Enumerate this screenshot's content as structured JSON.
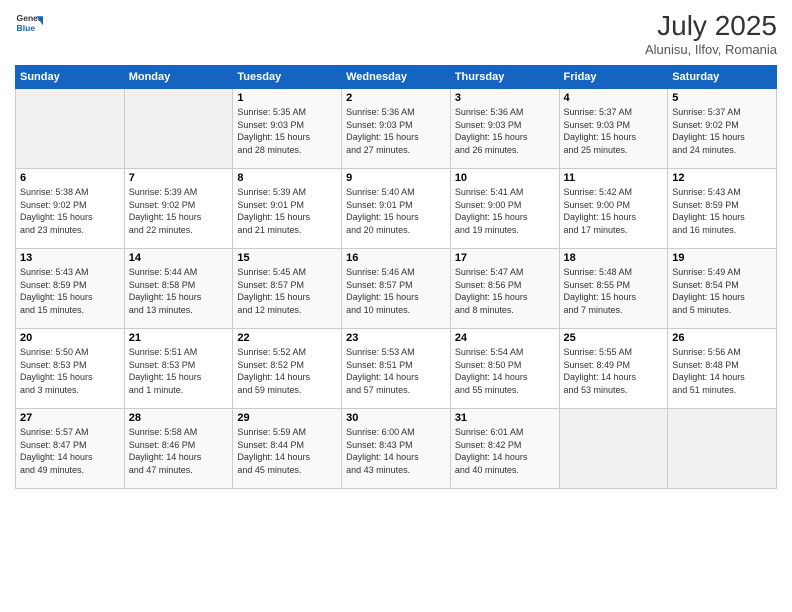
{
  "header": {
    "title": "July 2025",
    "subtitle": "Alunisu, Ilfov, Romania"
  },
  "days": [
    "Sunday",
    "Monday",
    "Tuesday",
    "Wednesday",
    "Thursday",
    "Friday",
    "Saturday"
  ],
  "weeks": [
    [
      {
        "day": "",
        "info": ""
      },
      {
        "day": "",
        "info": ""
      },
      {
        "day": "1",
        "info": "Sunrise: 5:35 AM\nSunset: 9:03 PM\nDaylight: 15 hours\nand 28 minutes."
      },
      {
        "day": "2",
        "info": "Sunrise: 5:36 AM\nSunset: 9:03 PM\nDaylight: 15 hours\nand 27 minutes."
      },
      {
        "day": "3",
        "info": "Sunrise: 5:36 AM\nSunset: 9:03 PM\nDaylight: 15 hours\nand 26 minutes."
      },
      {
        "day": "4",
        "info": "Sunrise: 5:37 AM\nSunset: 9:03 PM\nDaylight: 15 hours\nand 25 minutes."
      },
      {
        "day": "5",
        "info": "Sunrise: 5:37 AM\nSunset: 9:02 PM\nDaylight: 15 hours\nand 24 minutes."
      }
    ],
    [
      {
        "day": "6",
        "info": "Sunrise: 5:38 AM\nSunset: 9:02 PM\nDaylight: 15 hours\nand 23 minutes."
      },
      {
        "day": "7",
        "info": "Sunrise: 5:39 AM\nSunset: 9:02 PM\nDaylight: 15 hours\nand 22 minutes."
      },
      {
        "day": "8",
        "info": "Sunrise: 5:39 AM\nSunset: 9:01 PM\nDaylight: 15 hours\nand 21 minutes."
      },
      {
        "day": "9",
        "info": "Sunrise: 5:40 AM\nSunset: 9:01 PM\nDaylight: 15 hours\nand 20 minutes."
      },
      {
        "day": "10",
        "info": "Sunrise: 5:41 AM\nSunset: 9:00 PM\nDaylight: 15 hours\nand 19 minutes."
      },
      {
        "day": "11",
        "info": "Sunrise: 5:42 AM\nSunset: 9:00 PM\nDaylight: 15 hours\nand 17 minutes."
      },
      {
        "day": "12",
        "info": "Sunrise: 5:43 AM\nSunset: 8:59 PM\nDaylight: 15 hours\nand 16 minutes."
      }
    ],
    [
      {
        "day": "13",
        "info": "Sunrise: 5:43 AM\nSunset: 8:59 PM\nDaylight: 15 hours\nand 15 minutes."
      },
      {
        "day": "14",
        "info": "Sunrise: 5:44 AM\nSunset: 8:58 PM\nDaylight: 15 hours\nand 13 minutes."
      },
      {
        "day": "15",
        "info": "Sunrise: 5:45 AM\nSunset: 8:57 PM\nDaylight: 15 hours\nand 12 minutes."
      },
      {
        "day": "16",
        "info": "Sunrise: 5:46 AM\nSunset: 8:57 PM\nDaylight: 15 hours\nand 10 minutes."
      },
      {
        "day": "17",
        "info": "Sunrise: 5:47 AM\nSunset: 8:56 PM\nDaylight: 15 hours\nand 8 minutes."
      },
      {
        "day": "18",
        "info": "Sunrise: 5:48 AM\nSunset: 8:55 PM\nDaylight: 15 hours\nand 7 minutes."
      },
      {
        "day": "19",
        "info": "Sunrise: 5:49 AM\nSunset: 8:54 PM\nDaylight: 15 hours\nand 5 minutes."
      }
    ],
    [
      {
        "day": "20",
        "info": "Sunrise: 5:50 AM\nSunset: 8:53 PM\nDaylight: 15 hours\nand 3 minutes."
      },
      {
        "day": "21",
        "info": "Sunrise: 5:51 AM\nSunset: 8:53 PM\nDaylight: 15 hours\nand 1 minute."
      },
      {
        "day": "22",
        "info": "Sunrise: 5:52 AM\nSunset: 8:52 PM\nDaylight: 14 hours\nand 59 minutes."
      },
      {
        "day": "23",
        "info": "Sunrise: 5:53 AM\nSunset: 8:51 PM\nDaylight: 14 hours\nand 57 minutes."
      },
      {
        "day": "24",
        "info": "Sunrise: 5:54 AM\nSunset: 8:50 PM\nDaylight: 14 hours\nand 55 minutes."
      },
      {
        "day": "25",
        "info": "Sunrise: 5:55 AM\nSunset: 8:49 PM\nDaylight: 14 hours\nand 53 minutes."
      },
      {
        "day": "26",
        "info": "Sunrise: 5:56 AM\nSunset: 8:48 PM\nDaylight: 14 hours\nand 51 minutes."
      }
    ],
    [
      {
        "day": "27",
        "info": "Sunrise: 5:57 AM\nSunset: 8:47 PM\nDaylight: 14 hours\nand 49 minutes."
      },
      {
        "day": "28",
        "info": "Sunrise: 5:58 AM\nSunset: 8:46 PM\nDaylight: 14 hours\nand 47 minutes."
      },
      {
        "day": "29",
        "info": "Sunrise: 5:59 AM\nSunset: 8:44 PM\nDaylight: 14 hours\nand 45 minutes."
      },
      {
        "day": "30",
        "info": "Sunrise: 6:00 AM\nSunset: 8:43 PM\nDaylight: 14 hours\nand 43 minutes."
      },
      {
        "day": "31",
        "info": "Sunrise: 6:01 AM\nSunset: 8:42 PM\nDaylight: 14 hours\nand 40 minutes."
      },
      {
        "day": "",
        "info": ""
      },
      {
        "day": "",
        "info": ""
      }
    ]
  ]
}
